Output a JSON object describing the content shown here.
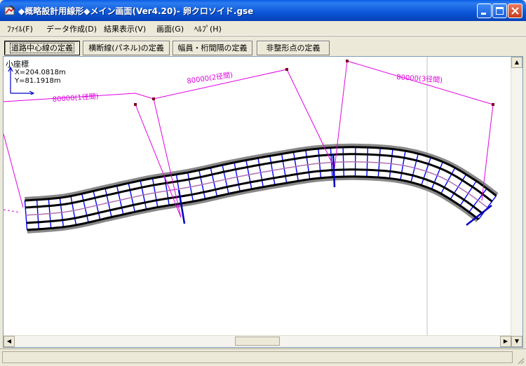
{
  "window": {
    "title": "◆概略設計用線形◆メイン画面(Ver4.20)- 卵クロソイド.gse",
    "controls": [
      "minimize",
      "maximize",
      "close"
    ]
  },
  "menu": [
    {
      "label": "ﾌｧｲﾙ(F)"
    },
    {
      "label": "データ作成(D)"
    },
    {
      "label": "結果表示(V)"
    },
    {
      "label": "画面(G)"
    },
    {
      "label": "ﾍﾙﾌﾟ(H)"
    }
  ],
  "toolbar": [
    {
      "label": "道路中心線の定義",
      "active": true
    },
    {
      "label": "横断線(パネル)の定義",
      "active": false
    },
    {
      "label": "幅員・桁間隔の定義",
      "active": false
    },
    {
      "label": "非整形点の定義",
      "active": false
    }
  ],
  "coords": {
    "title": "小座標",
    "x": "X=204.0818m",
    "y": "Y=81.1918m"
  },
  "spans": [
    {
      "label": "80000(1径間)"
    },
    {
      "label": "80000(2径間)"
    },
    {
      "label": "80000(3径間)"
    }
  ],
  "colors": {
    "span_line": "#e000e0",
    "girder": "#000000",
    "edge": "#888888",
    "cross_line": "#0000ff",
    "center_line": "#b070b0",
    "title_bar": "#0a55d8"
  },
  "icons": {
    "app": "app-icon",
    "scroll_up": "up-arrow-icon",
    "scroll_down": "down-arrow-icon",
    "scroll_left": "left-arrow-icon",
    "scroll_right": "right-arrow-icon"
  }
}
